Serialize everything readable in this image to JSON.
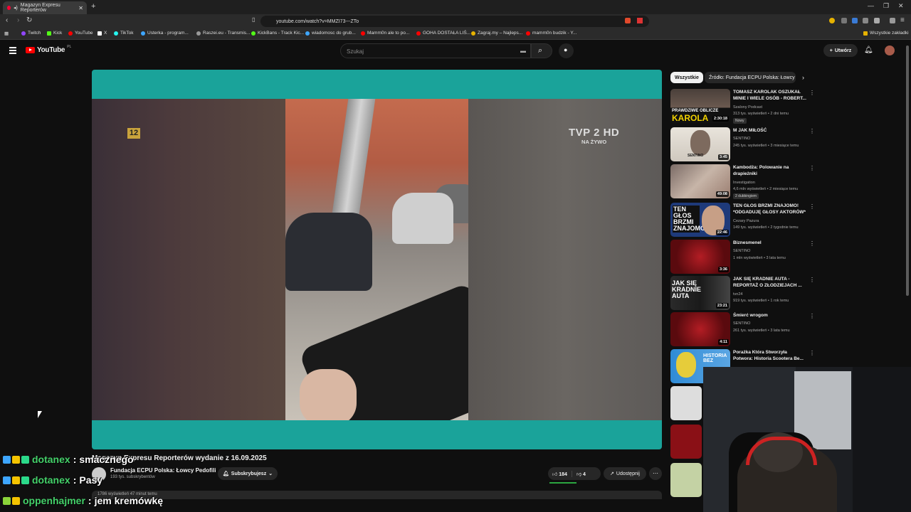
{
  "browser": {
    "tab_title": "Magazyn Expresu Reporterów",
    "url": "youtube.com/watch?v=MMZI73---ZTo",
    "bookmarks": [
      "Twitch",
      "Kick",
      "YouTube",
      "X",
      "TikTok",
      "Usterka - program...",
      "Raszei.eu - Transmis...",
      "KickBans - Track Kic...",
      "wiadomosc do grub...",
      "Mamm0n ale to po...",
      "GOHA DOSTAŁA LIŚ...",
      "Zagraj.my – Najleps...",
      "mamm0n budzik - Y..."
    ],
    "bookmarks_right": "Wszystkie zakładki"
  },
  "youtube": {
    "logo": "YouTube",
    "logo_region": "PL",
    "search_placeholder": "Szukaj",
    "create_label": "Utwórz"
  },
  "video": {
    "channel_badge": "12",
    "tv_logo": "TVP 2 HD",
    "tv_live": "NA ŻYWO",
    "title": "Magazyn Expresu Reporterów wydanie z 16.09.2025",
    "channel_name": "Fundacja ECPU Polska: Łowcy Pedofili",
    "channel_subs": "193 tys. subskrybentów",
    "subscribe_label": "Subskrybujesz",
    "likes": "184",
    "dislikes": "4",
    "share_label": "Udostępnij",
    "description_snippet": "1786 wyświetleń 47 minut temu"
  },
  "sidebar": {
    "chips": [
      "Wszystkie",
      "Źródło: Fundacja ECPU Polska: Łowcy"
    ],
    "recommendations": [
      {
        "title": "TOMASZ KAROLAK OSZUKAŁ MINIE I WIELE OSÓB - ROBERT...",
        "channel": "Szalony Podcast",
        "meta": "313 tys. wyświetleń • 2 dni temu",
        "badge": "Nowy",
        "duration": "2:30:18",
        "thumb_text": "PRAWDZIWE OBLICZE KAROLA"
      },
      {
        "title": "M JAK MIŁOŚĆ",
        "channel": "SENTINO",
        "meta": "245 tys. wyświetleń • 3 miesiące temu",
        "duration": "3:45",
        "thumb_text": "SENTINO"
      },
      {
        "title": "Kambodża: Polowanie na drapieżniki",
        "channel": "Investigation",
        "meta": "4,6 mln wyświetleń • 2 miesiące temu",
        "badge": "2 dubbingiem",
        "duration": "49:08",
        "thumb_text": ""
      },
      {
        "title": "TEN GŁOS BRZMI ZNAJOMO! *ODGADUJĘ GŁOSY AKTORÓW*",
        "channel": "Cezary Pazura",
        "meta": "149 tys. wyświetleń • 2 tygodnie temu",
        "duration": "22:46",
        "thumb_text": "TEN GŁOS BRZMI ZNAJOMO!"
      },
      {
        "title": "Biznesmenel",
        "channel": "SENTINO",
        "meta": "1 mln wyświetleń • 3 lata temu",
        "duration": "3:36",
        "thumb_text": ""
      },
      {
        "title": "JAK SIĘ KRADNIE AUTA - REPORTAŻ O ZŁODZIEJACH ...",
        "channel": "tvn24",
        "meta": "919 tys. wyświetleń • 1 rok temu",
        "duration": "23:21",
        "thumb_text": "JAK SIĘ KRADNIE AUTA"
      },
      {
        "title": "Śmierć wrogom",
        "channel": "SENTINO",
        "meta": "261 tys. wyświetleń • 3 lata temu",
        "duration": "4:11",
        "thumb_text": ""
      },
      {
        "title": "Porażka Która Stworzyła Potwora: Historia Scootera Be...",
        "channel": "Kamera",
        "meta": "historia jest pewna",
        "duration": "",
        "thumb_text": "HISTORIA BEZ"
      }
    ]
  },
  "chat": [
    {
      "user": "dotanex",
      "message": "smacznego"
    },
    {
      "user": "dotanex",
      "message": "Pasy"
    },
    {
      "user": "oppenhajmer",
      "message": "jem kremówkę"
    }
  ],
  "colors": {
    "player_border": "#1aa39a",
    "chat_user": "#44d16a",
    "youtube_red": "#ff0000"
  }
}
